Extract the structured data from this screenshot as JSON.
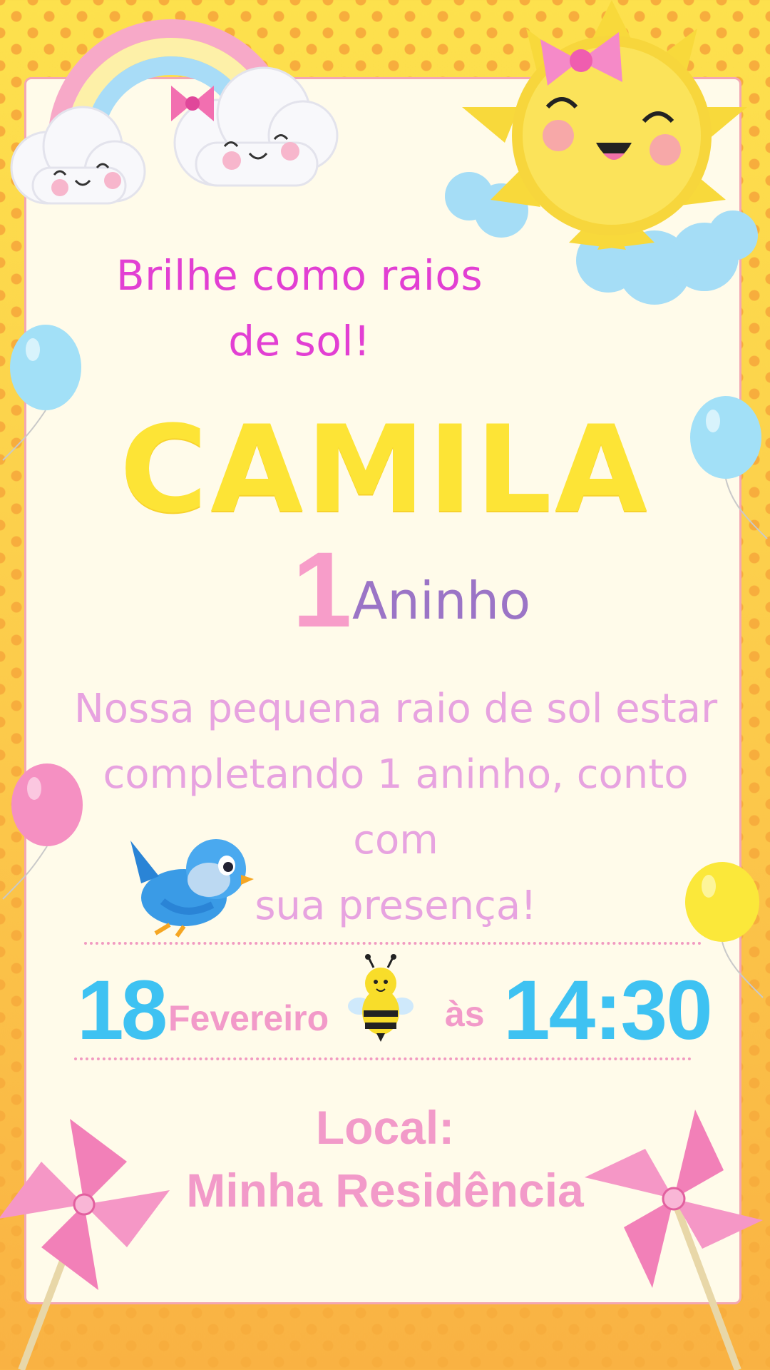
{
  "invitation": {
    "tagline_line1": "Brilhe como raios",
    "tagline_line2": "de sol!",
    "name": "CAMILA",
    "age_number": "1",
    "age_label": "Aninho",
    "message_line1": "Nossa pequena raio de sol estar",
    "message_line2": "completando 1 aninho, conto com",
    "message_line3": "sua presença!",
    "date_day": "18",
    "date_month": "Fevereiro",
    "date_at": "às",
    "date_time": "14:30",
    "location_label": "Local:",
    "location_value": "Minha Residência"
  },
  "decorations": {
    "icons": [
      "rainbow-icon",
      "cloud-icon",
      "sun-icon",
      "balloon-icon",
      "bird-icon",
      "bee-icon",
      "pinwheel-icon"
    ]
  },
  "colors": {
    "background": "#fbc24f",
    "card": "#fffbea",
    "name": "#fde436",
    "tagline": "#e23fd3",
    "pink": "#f29ac9",
    "blue": "#3ec2f2",
    "purple": "#9b74c6"
  }
}
